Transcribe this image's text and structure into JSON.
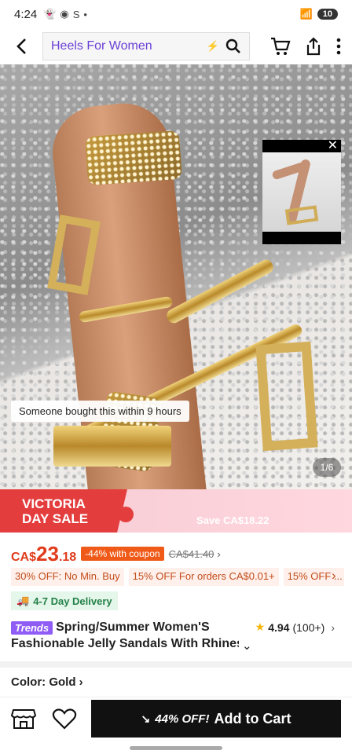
{
  "status": {
    "time": "4:24",
    "battery": "10"
  },
  "search": {
    "query": "Heels For Women"
  },
  "hero": {
    "toast": "Someone bought this within 9 hours",
    "pager": "1/6"
  },
  "promo_banner": {
    "line1": "VICTORIA",
    "line2": "DAY SALE",
    "save": "Save CA$18.22"
  },
  "price": {
    "currency": "CA$",
    "whole": "23",
    "cents": ".18",
    "coupon": "-44% with coupon",
    "original": "CA$41.40"
  },
  "promos": [
    "30% OFF: No Min. Buy",
    "15% OFF For orders CA$0.01+",
    "15% OFF ..."
  ],
  "delivery": "4-7 Day Delivery",
  "product": {
    "badge": "Trends",
    "title_line1": "Spring/Summer Women'S",
    "title_line2": "Fashionable Jelly Sandals With Rhinestones",
    "rating": "4.94",
    "reviews": "(100+)"
  },
  "color": {
    "label": "Color: Gold"
  },
  "cta": {
    "discount": "44% OFF!",
    "label": "Add to Cart"
  },
  "colors": {
    "accent_purple": "#6b3fd6",
    "price_red": "#e03b1b",
    "sale_red": "#e43d3d"
  }
}
